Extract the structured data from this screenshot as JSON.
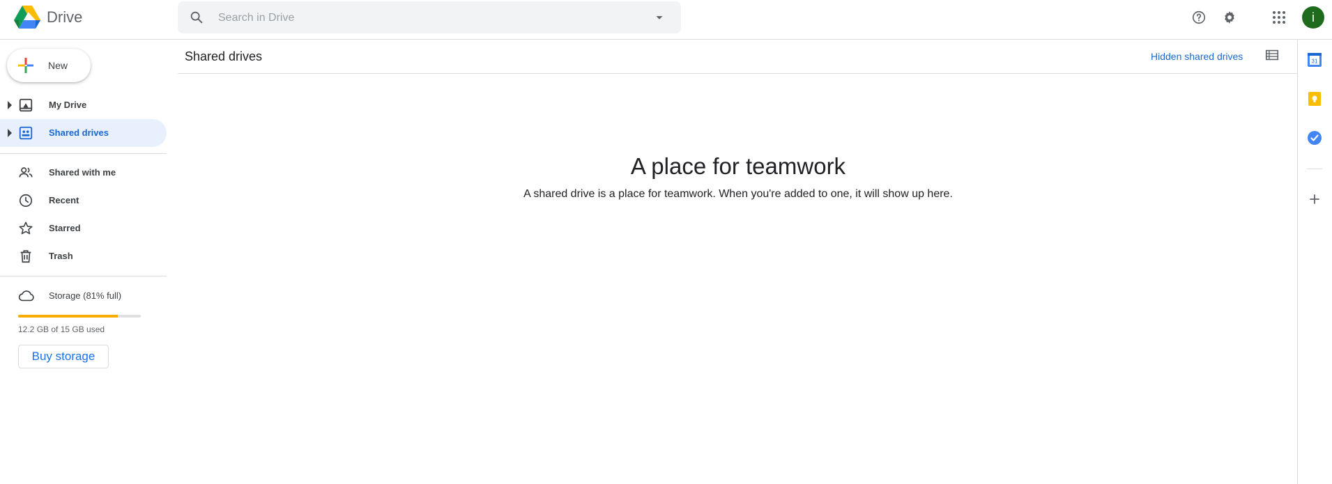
{
  "app": {
    "title": "Drive",
    "avatar_letter": "i",
    "accent_color": "#1a73e8"
  },
  "search": {
    "placeholder": "Search in Drive",
    "value": ""
  },
  "header_icons": [
    "help-icon",
    "settings-icon",
    "apps-grid-icon"
  ],
  "sidebar": {
    "new_label": "New",
    "items": [
      {
        "label": "My Drive",
        "icon": "my-drive-icon",
        "expandable": true,
        "active": false
      },
      {
        "label": "Shared drives",
        "icon": "shared-drives-icon",
        "expandable": true,
        "active": true
      },
      {
        "label": "Shared with me",
        "icon": "people-icon",
        "expandable": false,
        "active": false
      },
      {
        "label": "Recent",
        "icon": "clock-icon",
        "expandable": false,
        "active": false
      },
      {
        "label": "Starred",
        "icon": "star-icon",
        "expandable": false,
        "active": false
      },
      {
        "label": "Trash",
        "icon": "trash-icon",
        "expandable": false,
        "active": false
      }
    ],
    "storage": {
      "label": "Storage (81% full)",
      "used_text": "12.2 GB of 15 GB used",
      "percent": 81,
      "bar_color": "#f9ab00",
      "buy_label": "Buy storage"
    }
  },
  "main": {
    "title": "Shared drives",
    "hidden_link": "Hidden shared drives",
    "empty_title": "A place for teamwork",
    "empty_desc": "A shared drive is a place for teamwork. When you're added to one, it will show up here."
  },
  "side_panel": {
    "icons": [
      "calendar-icon",
      "keep-icon",
      "tasks-icon",
      "add-icon"
    ],
    "calendar_day": "31"
  }
}
